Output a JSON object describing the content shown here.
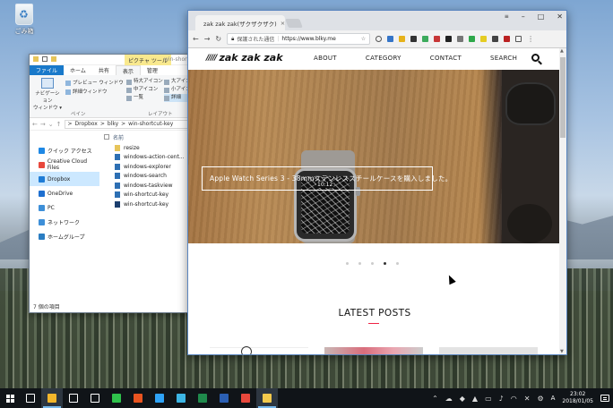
{
  "desktop": {
    "recycle_bin_label": "ごみ箱"
  },
  "explorer": {
    "context_tab": "ピクチャ ツール",
    "title": "win-shortcut-key",
    "tabs": [
      "ファイル",
      "ホーム",
      "共有",
      "表示",
      "管理"
    ],
    "ribbon": {
      "nav_pane": "ナビゲーション\nウィンドウ",
      "nav_pane_line1": "ナビゲーション",
      "nav_pane_line2": "ウィンドウ ▾",
      "preview_pane": "プレビュー ウィンドウ",
      "details_pane": "詳細ウィンドウ",
      "layout": [
        "特大アイコン",
        "中アイコン",
        "一覧"
      ],
      "layout2": [
        "大アイコン",
        "小アイコン",
        "詳細"
      ],
      "group_panes": "ペイン",
      "group_layout": "レイアウト"
    },
    "breadcrumb": [
      "Dropbox",
      "blky",
      "win-shortcut-key"
    ],
    "breadcrumb_sep": ">",
    "nav_items": [
      {
        "label": "クイック アクセス",
        "icon": "star-icon",
        "color": "#1e88e5"
      },
      {
        "label": "Creative Cloud Files",
        "icon": "creative-cloud-icon",
        "color": "#e8483c"
      },
      {
        "label": "Dropbox",
        "icon": "dropbox-icon",
        "color": "#1f7cd6"
      },
      {
        "label": "OneDrive",
        "icon": "onedrive-icon",
        "color": "#1e6fd0"
      },
      {
        "label": "PC",
        "icon": "pc-icon",
        "color": "#3d8fd8"
      },
      {
        "label": "ネットワーク",
        "icon": "network-icon",
        "color": "#3d8fd8"
      },
      {
        "label": "ホームグループ",
        "icon": "homegroup-icon",
        "color": "#2a7dc2"
      }
    ],
    "column_header": "名前",
    "files": [
      {
        "name": "resize",
        "icon": "folder-icon",
        "color": "#e7c55a"
      },
      {
        "name": "windows-action-cent...",
        "icon": "image-file-icon",
        "color": "#2d6fb3"
      },
      {
        "name": "windows-explorer",
        "icon": "image-file-icon",
        "color": "#2d6fb3"
      },
      {
        "name": "windows-search",
        "icon": "image-file-icon",
        "color": "#2d6fb3"
      },
      {
        "name": "windows-taskview",
        "icon": "image-file-icon",
        "color": "#2d6fb3"
      },
      {
        "name": "win-shortcut-key",
        "icon": "image-file-icon",
        "color": "#2d6fb3"
      },
      {
        "name": "win-shortcut-key",
        "icon": "image-file-icon",
        "color": "#1b3e6e"
      }
    ],
    "status": "7 個の項目"
  },
  "browser": {
    "tab_title": "zak zak zak(ザクザクザク)",
    "tab_close": "×",
    "secure_label": "保護された通信",
    "url": "https://www.blky.me",
    "site": {
      "logo": "zak zak zak",
      "logo_mark": "/////",
      "nav": [
        "ABOUT",
        "CATEGORY",
        "CONTACT",
        "SEARCH"
      ],
      "hero_caption": "Apple Watch Series 3 - 38mmステンレススチールケースを購入しました。",
      "watch_time": "10:12",
      "slider_dots": 5,
      "active_dot": 4,
      "latest_posts": "LATEST POSTS"
    }
  },
  "taskbar": {
    "apps": [
      {
        "name": "task-view-icon",
        "color": "#ffffff"
      },
      {
        "name": "chrome-icon",
        "color": "#f2b62b"
      },
      {
        "name": "store-icon",
        "color": "#ffffff"
      },
      {
        "name": "mail-icon",
        "color": "#ffffff"
      },
      {
        "name": "line-icon",
        "color": "#2fc24b"
      },
      {
        "name": "ubuntu-icon",
        "color": "#e95420"
      },
      {
        "name": "photoshop-icon",
        "color": "#2fa3f7"
      },
      {
        "name": "lightroom-icon",
        "color": "#3db6e5"
      },
      {
        "name": "excel-icon",
        "color": "#1f8a4c"
      },
      {
        "name": "word-icon",
        "color": "#2b5fb3"
      },
      {
        "name": "creative-cloud-icon",
        "color": "#e8483c"
      },
      {
        "name": "explorer-icon",
        "color": "#f2c94c"
      }
    ],
    "time": "23:02",
    "date": "2018/01/05",
    "ime": "A"
  }
}
